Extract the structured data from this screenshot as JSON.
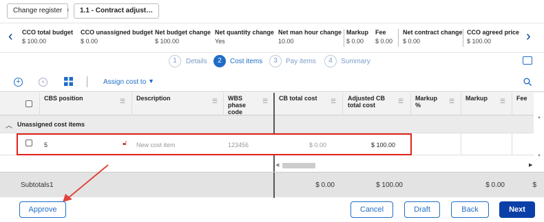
{
  "breadcrumb": {
    "items": [
      "Change register",
      "1.1 - Contract adjust…"
    ],
    "sep": "›"
  },
  "summary": {
    "items": [
      {
        "label": "CCO total budget",
        "value": "$ 100.00"
      },
      {
        "label": "CCO unassigned budget",
        "value": "$ 0.00"
      },
      {
        "label": "Net budget change",
        "value": "$ 100.00"
      },
      {
        "label": "Net quantity change",
        "value": "Yes"
      },
      {
        "label": "Net man hour change",
        "value": "10.00"
      },
      {
        "label": "Markup",
        "value": "$ 0.00"
      },
      {
        "label": "Fee",
        "value": "$ 0.00"
      },
      {
        "label": "Net contract change",
        "value": "$ 0.00"
      },
      {
        "label": "CCO agreed price",
        "value": "$ 100.00"
      }
    ]
  },
  "steps": [
    {
      "num": "1",
      "label": "Details"
    },
    {
      "num": "2",
      "label": "Cost items"
    },
    {
      "num": "3",
      "label": "Pay items"
    },
    {
      "num": "4",
      "label": "Summary"
    }
  ],
  "toolbar": {
    "assign_label": "Assign cost to"
  },
  "columns": [
    "CBS position",
    "Description",
    "WBS phase code",
    "CB total cost",
    "Adjusted CB total cost",
    "Markup %",
    "Markup",
    "Fee"
  ],
  "columns_split": {
    "wbs": [
      "WBS",
      "phase",
      "code"
    ],
    "adjusted": [
      "Adjusted CB",
      "total cost"
    ],
    "markup_pct": [
      "Markup",
      "%"
    ]
  },
  "group": {
    "label": "Unassigned cost items"
  },
  "row": {
    "cbs": "5",
    "description": "New cost item",
    "wbs": "123456",
    "cb_total": "$ 0.00",
    "adjusted": "$ 100.00"
  },
  "subtotals": {
    "label": "Subtotals",
    "count": "1",
    "cb_total": "$ 0.00",
    "adjusted": "$ 100.00",
    "markup": "$ 0.00",
    "fee": "$"
  },
  "buttons": {
    "approve": "Approve",
    "cancel": "Cancel",
    "draft": "Draft",
    "back": "Back",
    "next": "Next"
  },
  "colors": {
    "accent": "#1f6dc7",
    "primary": "#0b3fa8",
    "highlight": "#e0201b"
  }
}
